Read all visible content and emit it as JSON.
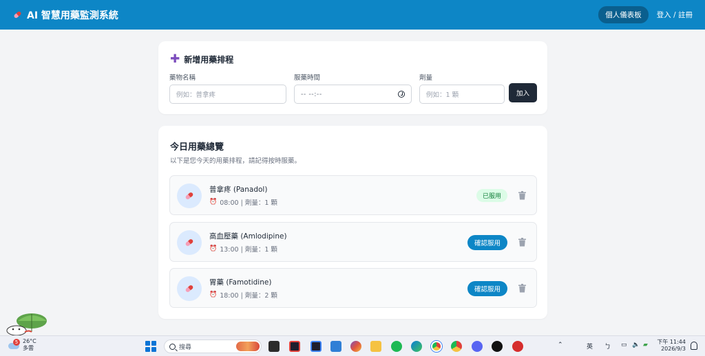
{
  "header": {
    "app_title": "AI 智慧用藥監測系統",
    "dashboard_label": "個人儀表板",
    "login_label": "登入 / 註冊"
  },
  "add_form": {
    "title": "新增用藥排程",
    "name_label": "藥物名稱",
    "name_placeholder": "例如：普拿疼",
    "time_label": "服藥時間",
    "time_value": "-- --:--",
    "dose_label": "劑量",
    "dose_placeholder": "例如：1 顆",
    "submit_label": "加入"
  },
  "overview": {
    "title": "今日用藥總覽",
    "subtitle": "以下是您今天的用藥排程，請記得按時服藥。",
    "items": [
      {
        "name": "普拿疼 (Panadol)",
        "meta": "08:00 | 劑量：1 顆",
        "status": "已服用",
        "taken": true
      },
      {
        "name": "高血壓藥 (Amlodipine)",
        "meta": "13:00 | 劑量：1 顆",
        "status": "確認服用",
        "taken": false
      },
      {
        "name": "胃藥 (Famotidine)",
        "meta": "18:00 | 劑量：2 顆",
        "status": "確認服用",
        "taken": false
      }
    ]
  },
  "taskbar": {
    "weather_badge": "5",
    "temperature": "26°C",
    "condition": "多雲",
    "search_placeholder": "搜尋",
    "ime_label": "英",
    "time": "下午 11:44",
    "date": "2026/9/3"
  },
  "colors": {
    "header": "#0d86c6",
    "primary_button": "#0d86c6",
    "dark_button": "#1f2937",
    "taken_badge_bg": "#dcfce7",
    "taken_badge_text": "#15803d",
    "plus_accent": "#7c4dbd"
  }
}
